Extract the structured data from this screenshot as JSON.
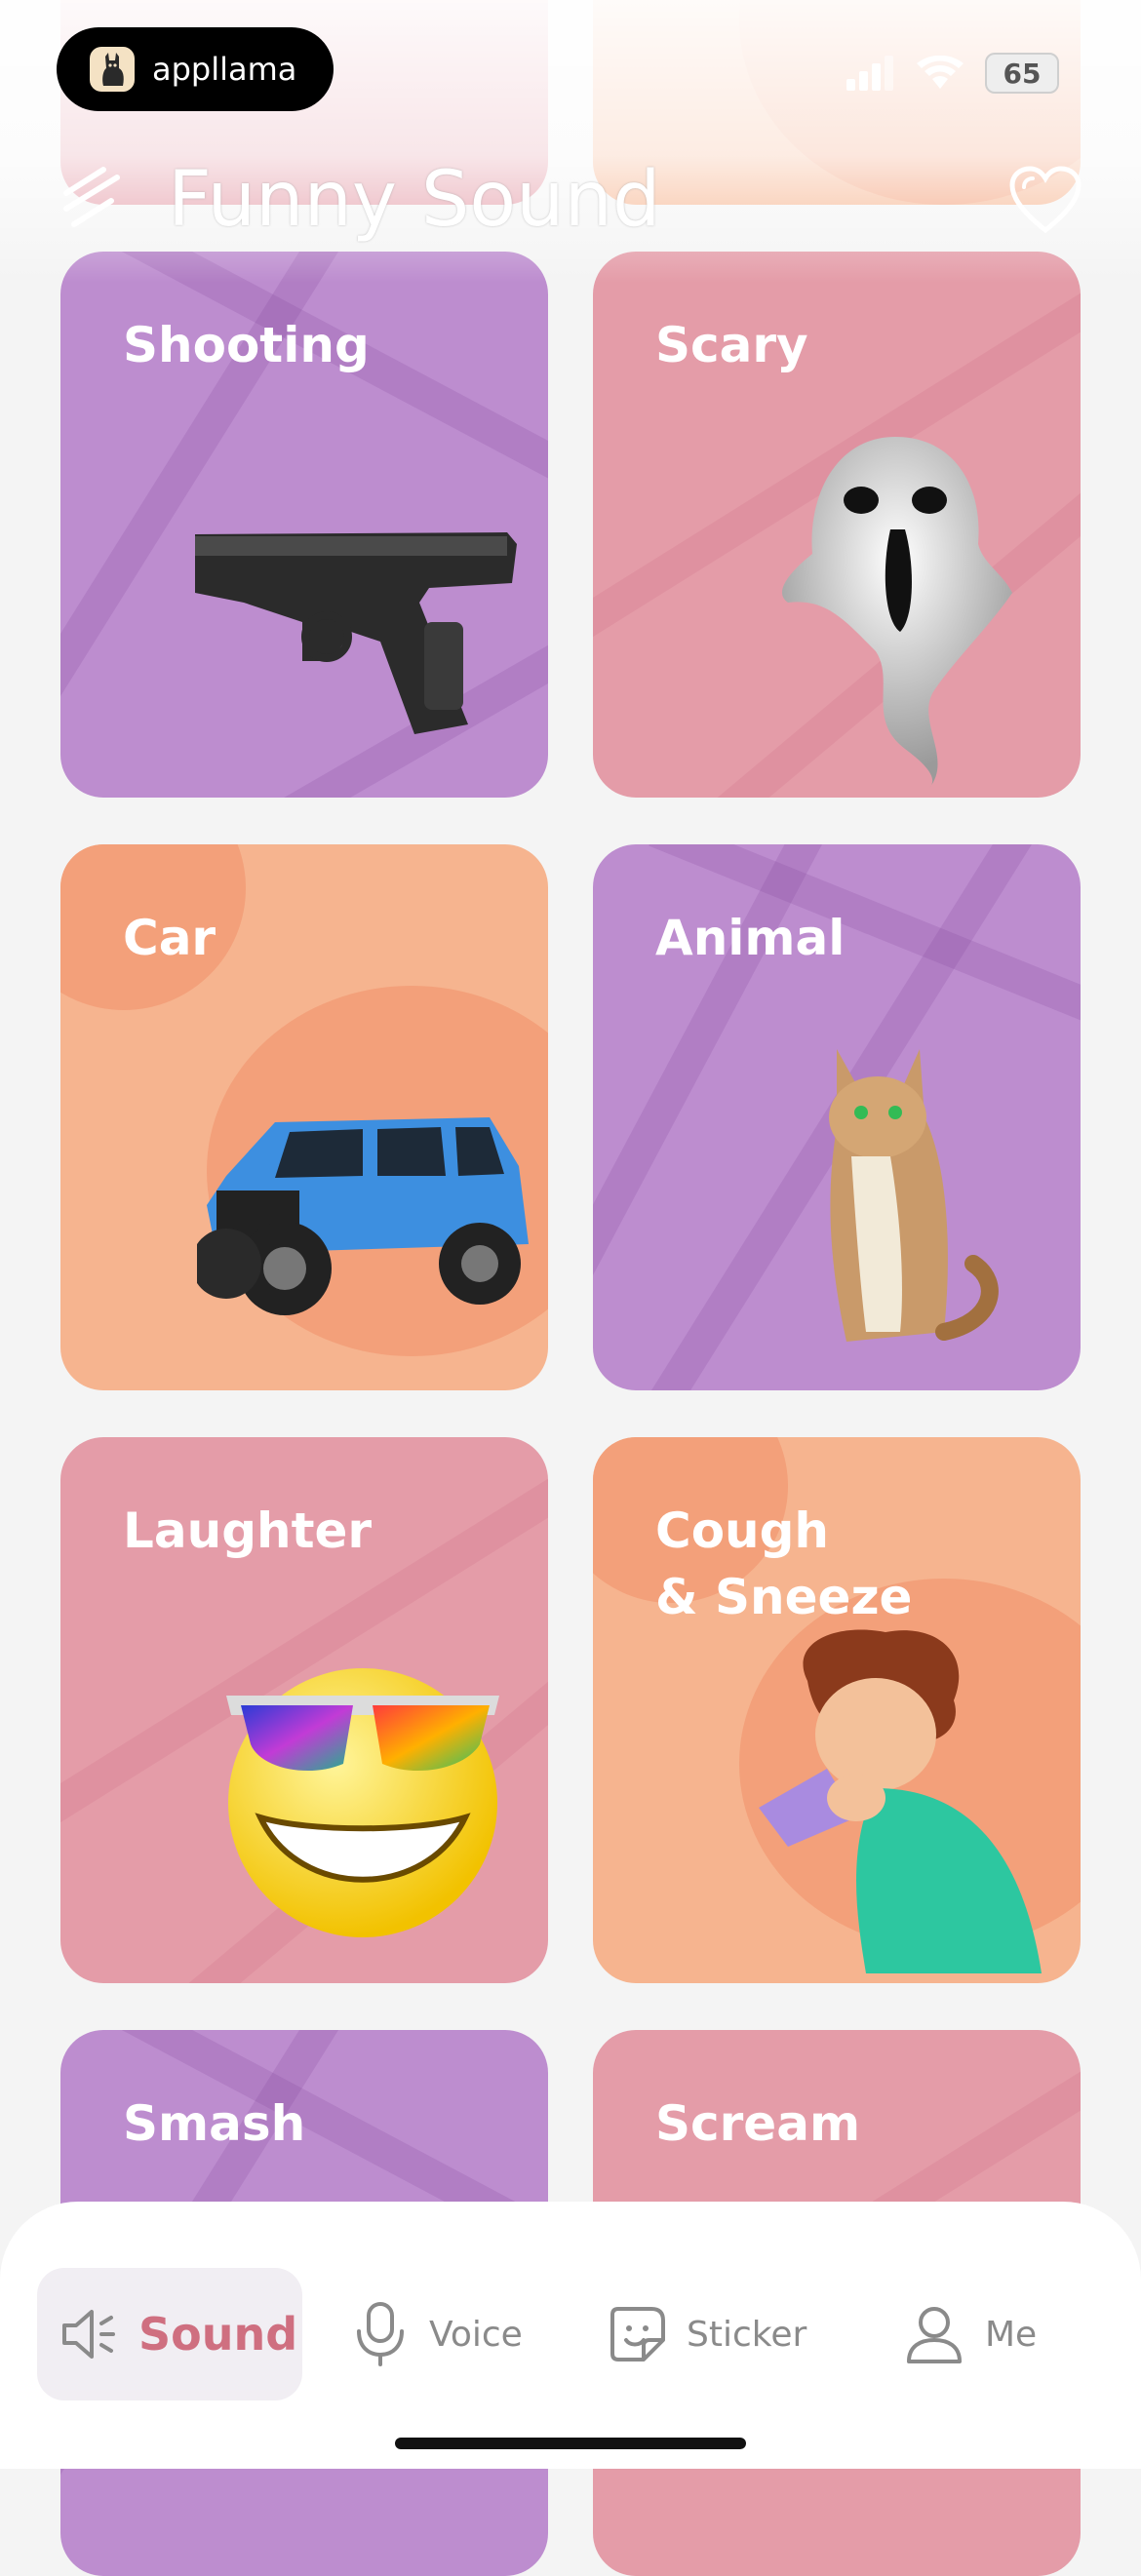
{
  "status_bar": {
    "app_badge": "appllama",
    "battery": "65"
  },
  "header": {
    "title": "Funny Sound"
  },
  "categories": [
    {
      "label": "Shooting",
      "theme": "purple",
      "icon": "pistol-icon"
    },
    {
      "label": "Scary",
      "theme": "pink",
      "icon": "ghost-icon"
    },
    {
      "label": "Car",
      "theme": "peach",
      "icon": "jeep-icon"
    },
    {
      "label": "Animal",
      "theme": "purple",
      "icon": "cat-icon"
    },
    {
      "label": "Laughter",
      "theme": "pink",
      "icon": "laughing-emoji-icon"
    },
    {
      "label": "Cough\n& Sneeze",
      "theme": "peach",
      "icon": "sneezing-boy-icon"
    },
    {
      "label": "Smash",
      "theme": "purple",
      "icon": ""
    },
    {
      "label": "Scream",
      "theme": "pink",
      "icon": ""
    }
  ],
  "bottom_nav": {
    "items": [
      {
        "label": "Sound",
        "icon": "speaker-icon",
        "active": true
      },
      {
        "label": "Voice",
        "icon": "microphone-icon",
        "active": false
      },
      {
        "label": "Sticker",
        "icon": "sticker-icon",
        "active": false
      },
      {
        "label": "Me",
        "icon": "user-icon",
        "active": false
      }
    ]
  },
  "colors": {
    "purple": "#bd8dcf",
    "pink": "#e49ca8",
    "peach": "#f6b48f",
    "accent": "#cf6f80"
  }
}
